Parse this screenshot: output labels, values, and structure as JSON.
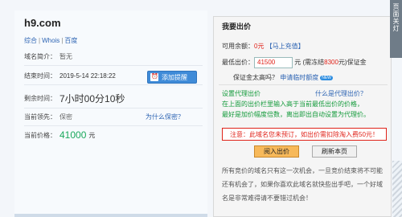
{
  "domain": "h9.com",
  "links": [
    "综合",
    "Whois",
    "百度"
  ],
  "left_rows": {
    "intro": {
      "label": "域名简介：",
      "value": "暂无"
    },
    "end_time": {
      "label": "结束时间：",
      "value": "2019-5-14 22:18:22"
    },
    "remind_button": "添加提醒",
    "remind_icon": "clock-icon",
    "remaining": {
      "label": "剩余时间：",
      "value": "7小时00分10秒"
    },
    "leader": {
      "label": "当前领先：",
      "value": "保密",
      "why": "为什么保密？"
    },
    "price": {
      "label": "当前价格：",
      "value": "41000",
      "unit": "元"
    }
  },
  "right": {
    "title": "我要出价",
    "balance_label": "可用余额：",
    "balance_value": "0元",
    "recharge": "【马上充值】",
    "min_bid_label": "最低出价：",
    "bid_value": "41500",
    "bid_unit": "元",
    "freeze_prefix": "(需冻结",
    "freeze_value": "8300",
    "freeze_suffix": "元)保证金",
    "deposit_question": "保证金太高吗？",
    "temp_quota": "申请临时额度",
    "new_badge": "NEW",
    "proxy_label": "设置代理出价",
    "proxy_question": "什么是代理出价？",
    "proxy_desc_1": "在上面的出价栏里输入高于当前最低出价的价格，",
    "proxy_desc_2": "最好是加价幅度倍数，离出即出自动设置为代理价。",
    "notice": "注意：此域名您未预订，如出价需扣除淘入费50元！",
    "bid_button": "阅入出价",
    "refresh_button": "刷新本页",
    "paragraph": "所有竞价的域名只有这一次机会，一旦竞价结束将不可能还有机会了，如果你喜欢此域名就快些出手吧，一个好域名是非常难得请不要错过机会！"
  },
  "side_tab": [
    "页",
    "面",
    "关",
    "灯"
  ],
  "colors": {
    "price_green": "#1aa85c",
    "link_blue": "#2d64b3",
    "alert_red": "#e0231a",
    "button_orange": "#f7b95a"
  }
}
